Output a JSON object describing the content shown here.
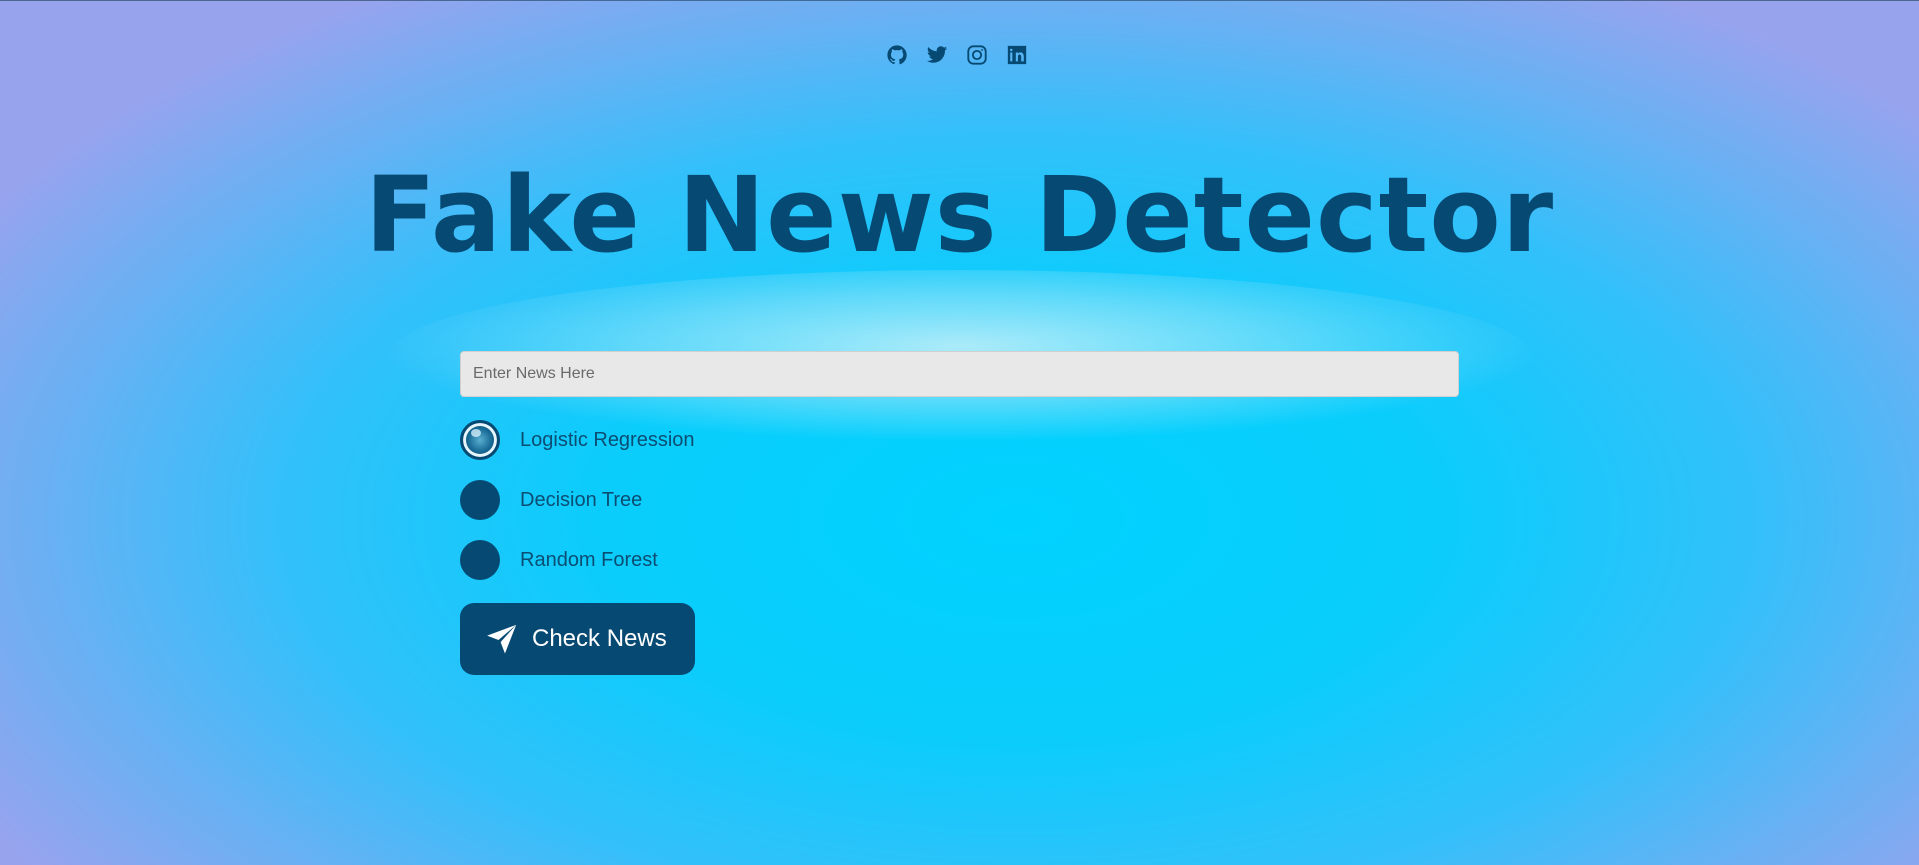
{
  "social": {
    "icons": [
      "github-icon",
      "twitter-icon",
      "instagram-icon",
      "linkedin-icon"
    ]
  },
  "title": "Fake News Detector",
  "news_input": {
    "placeholder": "Enter News Here",
    "value": ""
  },
  "options": [
    {
      "label": "Logistic Regression",
      "selected": true
    },
    {
      "label": "Decision Tree",
      "selected": false
    },
    {
      "label": "Random Forest",
      "selected": false
    }
  ],
  "button": {
    "label": "Check News",
    "icon": "paper-plane-icon"
  },
  "colors": {
    "primary": "#064a73",
    "background_center": "#00d2ff",
    "background_edge": "#98a3ee",
    "input_background": "#e8e8e8",
    "button_text": "#ffffff"
  }
}
